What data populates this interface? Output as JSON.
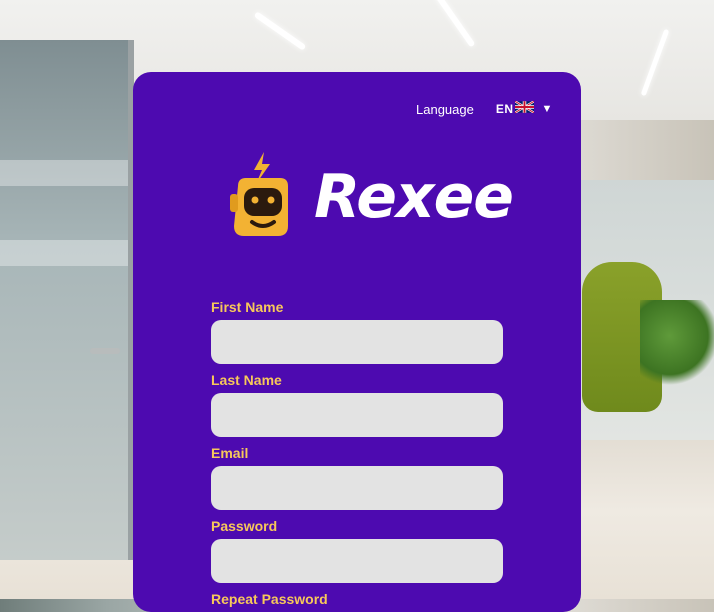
{
  "header": {
    "language_label": "Language",
    "language_code": "EN",
    "flag_icon": "uk-flag-icon",
    "dropdown_icon": "caret-down-icon"
  },
  "brand": {
    "name": "Rexee",
    "logo_icon": "robot-mascot-icon"
  },
  "form": {
    "fields": [
      {
        "label": "First Name",
        "value": "",
        "placeholder": ""
      },
      {
        "label": "Last Name",
        "value": "",
        "placeholder": ""
      },
      {
        "label": "Email",
        "value": "",
        "placeholder": ""
      },
      {
        "label": "Password",
        "value": "",
        "placeholder": ""
      },
      {
        "label": "Repeat Password",
        "value": "",
        "placeholder": ""
      }
    ]
  },
  "colors": {
    "card_background": "#4d0ab0",
    "label_color": "#f7c85a",
    "input_background": "#e3e3e3",
    "logo_yellow": "#f3b233"
  }
}
